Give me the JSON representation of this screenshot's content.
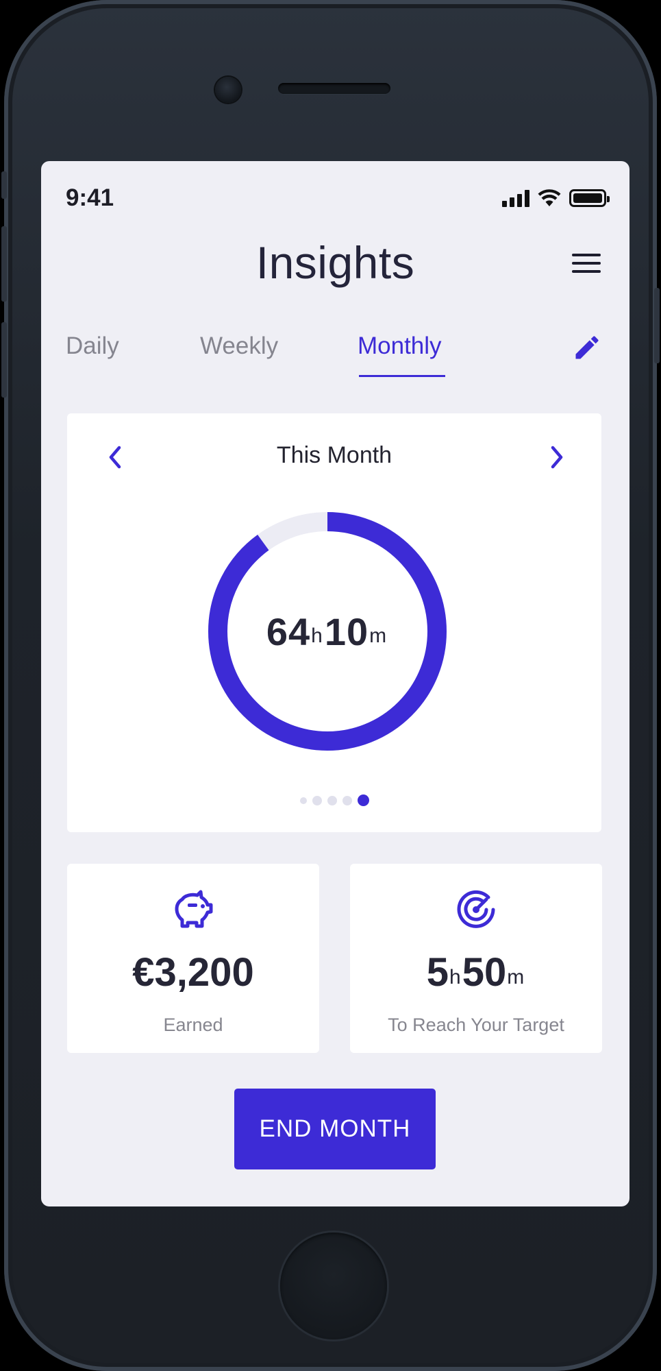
{
  "status_bar": {
    "time": "9:41"
  },
  "header": {
    "title": "Insights"
  },
  "tabs": [
    {
      "label": "Daily",
      "active": false
    },
    {
      "label": "Weekly",
      "active": false
    },
    {
      "label": "Monthly",
      "active": true
    }
  ],
  "summary_card": {
    "title": "This Month",
    "total": {
      "hours": "64",
      "hours_unit": "h",
      "minutes": "10",
      "minutes_unit": "m"
    },
    "progress_fraction": 0.9,
    "pager": {
      "pages": 5,
      "active_page": 5
    }
  },
  "earned_card": {
    "icon": "piggy-bank-icon",
    "value": "€3,200",
    "label": "Earned"
  },
  "target_card": {
    "icon": "target-icon",
    "hours": "5",
    "hours_unit": "h",
    "minutes": "50",
    "minutes_unit": "m",
    "label": "To Reach Your Target"
  },
  "end_button": {
    "label": "END MONTH"
  },
  "colors": {
    "accent": "#3d2bd6",
    "screen_bg": "#efeff5",
    "track": "#ececf4",
    "text": "#262636"
  }
}
